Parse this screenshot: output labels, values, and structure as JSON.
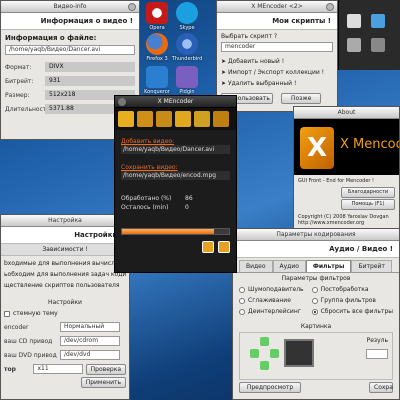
{
  "desktop": {
    "icons": [
      {
        "name": "Opera",
        "label": "Opera",
        "color": "#c41a1a"
      },
      {
        "name": "Skype",
        "label": "Skype",
        "color": "#1aa0e0"
      },
      {
        "name": "Firefox",
        "label": "Firefox 3",
        "color": "#e86a12"
      },
      {
        "name": "Thunderbird",
        "label": "Thunderbird",
        "color": "#2a5fb8"
      },
      {
        "name": "Konqueror",
        "label": "Konqueror",
        "color": "#2a7fd0"
      },
      {
        "name": "Pidgin",
        "label": "Pidgin",
        "color": "#7a5fc0"
      }
    ]
  },
  "video_info": {
    "title": "Видео-info",
    "header": "Информация о видео !",
    "file_label": "Информация о файле:",
    "file_path": "/home/yaqb/Видео/Dancer.avi",
    "rows": [
      {
        "label": "Формат:",
        "value": "DIVX"
      },
      {
        "label": "Битрейт:",
        "value": "931"
      },
      {
        "label": "Размер:",
        "value": "512x218"
      },
      {
        "label": "Длительность:",
        "value": "5371.88"
      }
    ]
  },
  "scripts": {
    "title": "X MEncoder <2>",
    "header": "Мои скрипты !",
    "select_label": "Выбрать скрипт ?",
    "select_value": "mencoder",
    "items": [
      "Добавить новый !",
      "Импорт / Экспорт коллекции !",
      "Удалить выбранный !"
    ],
    "use_button": "Использовать",
    "later_button": "Позже"
  },
  "main": {
    "title": "X MEncoder",
    "add_video": "Добавить видео:",
    "input_path": "/home/yaqb/Видео/Dancer.avi",
    "save_video": "Сохранить видео:",
    "output_path": "/home/yaqb/Видео/encod.mpg",
    "processed_label": "Обработано (%)",
    "processed_value": "86",
    "remaining_label": "Осталось   (min)",
    "remaining_value": "0",
    "progress": 0.86
  },
  "about": {
    "title": "About",
    "logo_x": "X",
    "logo_text": "X Mencoder",
    "desc": "GUI Front - End for Mencoder !",
    "btn_thanks": "Благодарности",
    "btn_help": "Помощь (F1)",
    "copyright": "Copyright (C) 2008 Yaroslav Dovgan",
    "url": "http://www.xmencoder.org"
  },
  "params": {
    "title": "Параметры кодирования",
    "header": "Аудио / Видео !",
    "tabs": [
      "Видео",
      "Аудио",
      "Фильтры",
      "Битрейт"
    ],
    "section": "Параметры фильтров",
    "left_opts": [
      "Шумоподавитель",
      "Сглаживание",
      "Деинтерлейсинг"
    ],
    "right_opts": [
      "Постобработка",
      "Группа фильтров",
      "Сбросить все фильтры"
    ],
    "picture": "Картинка",
    "res_label": "Резуль",
    "preview": "Предпросмотр",
    "ok": "Сохра"
  },
  "settings": {
    "title": "Настройка",
    "header": "Настройки !",
    "deps": "Зависимости !",
    "dep_lines": [
      "bходимые для выполнения вычислительных задач",
      "ьобходим для выполнения задач кодирования",
      "ществление скриптов пользователя"
    ],
    "settings_label": "Настройки",
    "theme_label": "стемную тему",
    "encoder_label": "encoder",
    "encoder_value": "Нормальный",
    "cd_label": "ваш CD привод",
    "cd_value": "/dev/cdrom",
    "dvd_label": "ваш DVD привод",
    "dvd_value": "/dev/dvd",
    "player_label": "тор",
    "player_value": "x11",
    "check": "Проверка",
    "apply": "Применить"
  }
}
